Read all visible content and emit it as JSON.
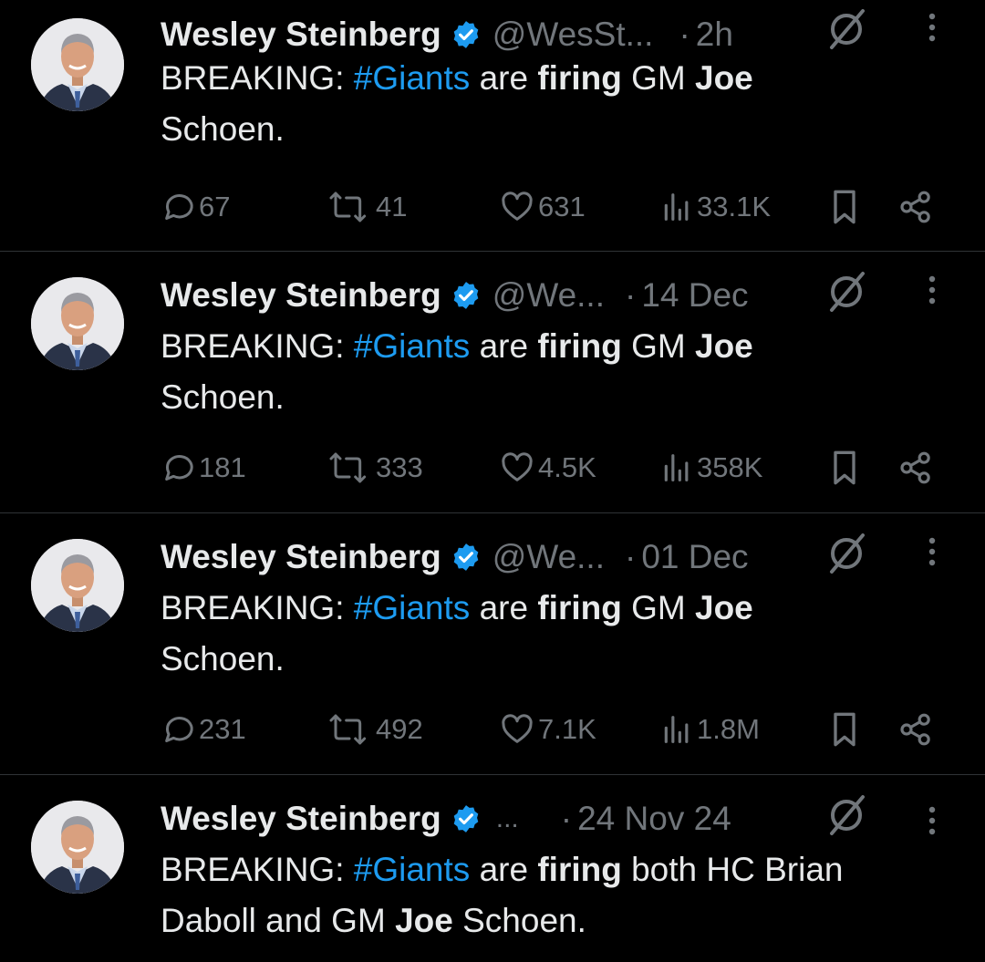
{
  "tweets": [
    {
      "name": "Wesley Steinberg",
      "handle": "@WesSt...",
      "dot": "·",
      "time": "2h",
      "text": [
        "BREAKING: ",
        "#Giants",
        " are ",
        "firing",
        " GM ",
        "Joe",
        " Schoen."
      ],
      "stats": {
        "replies": "67",
        "reposts": "41",
        "likes": "631",
        "views": "33.1K"
      }
    },
    {
      "name": "Wesley Steinberg",
      "handle": "@We...",
      "dot": "·",
      "time": "14 Dec",
      "text": [
        "BREAKING: ",
        "#Giants",
        " are ",
        "firing",
        " GM ",
        "Joe",
        " Schoen."
      ],
      "stats": {
        "replies": "181",
        "reposts": "333",
        "likes": "4.5K",
        "views": "358K"
      }
    },
    {
      "name": "Wesley Steinberg",
      "handle": "@We...",
      "dot": "·",
      "time": "01 Dec",
      "text": [
        "BREAKING: ",
        "#Giants",
        " are ",
        "firing",
        " GM ",
        "Joe",
        " Schoen."
      ],
      "stats": {
        "replies": "231",
        "reposts": "492",
        "likes": "7.1K",
        "views": "1.8M"
      }
    },
    {
      "name": "Wesley Steinberg",
      "handle": "...",
      "dot": "·",
      "time": "24 Nov 24",
      "text": [
        "BREAKING: ",
        "#Giants",
        " are ",
        "firing",
        " both HC Brian Daboll and GM ",
        "Joe",
        " Schoen."
      ]
    }
  ],
  "icons": {
    "verified": "verified-badge-icon",
    "grok": "grok-slash-icon",
    "more": "more-vertical-icon",
    "reply": "reply-bubble-icon",
    "repost": "repost-arrows-icon",
    "like": "heart-icon",
    "views": "views-bars-icon",
    "bookmark": "bookmark-icon",
    "share": "share-icon"
  },
  "colors": {
    "background": "#000000",
    "text": "#e7e9ea",
    "muted": "#71767b",
    "accent": "#1d9bf0",
    "divider": "#2f3336"
  }
}
